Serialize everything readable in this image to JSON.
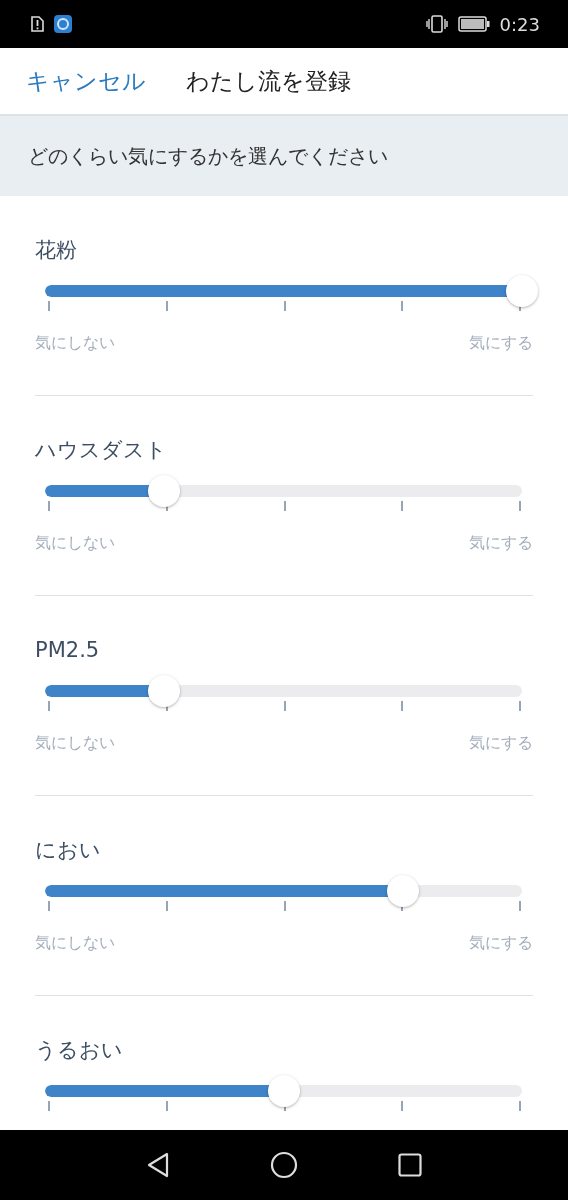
{
  "status_bar": {
    "time": "0:23"
  },
  "header": {
    "cancel": "キャンセル",
    "title": "わたし流を登録"
  },
  "instruction": "どのくらい気にするかを選んでください",
  "sliders": [
    {
      "label": "花粉",
      "level": 1,
      "min_label": "気にしない",
      "max_label": "気にする"
    },
    {
      "label": "ハウスダスト",
      "level": 0.25,
      "min_label": "気にしない",
      "max_label": "気にする"
    },
    {
      "label": "PM2.5",
      "level": 0.25,
      "min_label": "気にしない",
      "max_label": "気にする"
    },
    {
      "label": "におい",
      "level": 0.75,
      "min_label": "気にしない",
      "max_label": "気にする"
    },
    {
      "label": "うるおい",
      "level": 0.5
    }
  ]
}
